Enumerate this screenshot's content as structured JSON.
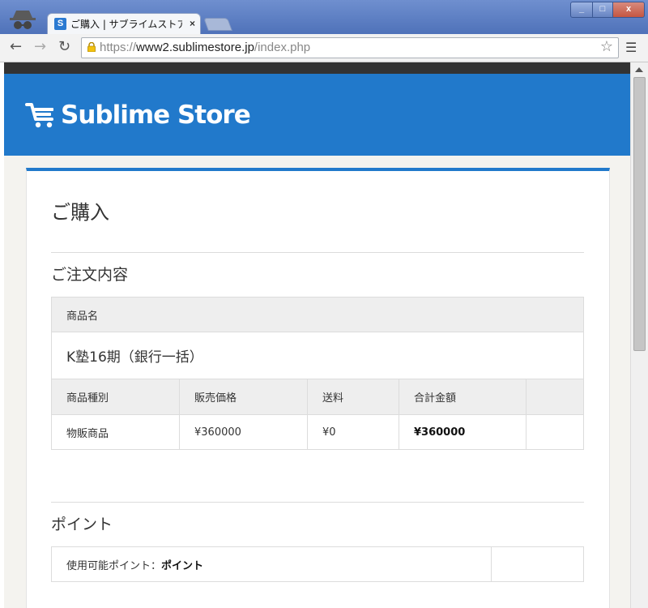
{
  "browser": {
    "tab_title": "ご購入 | サブライムストア",
    "tab_favicon": "S",
    "tab_close": "×",
    "url_scheme": "https://",
    "url_host": "www2.sublimestore.jp",
    "url_path": "/index.php",
    "icons": [
      "incognito-icon",
      "back-icon",
      "forward-icon",
      "reload-icon",
      "lock-icon",
      "star-icon",
      "menu-icon"
    ]
  },
  "site": {
    "brand": "Sublime Store",
    "brand_color": "#2179cb"
  },
  "page": {
    "title": "ご購入",
    "order_section_title": "ご注文内容",
    "product_name_header": "商品名",
    "product_name": "K塾16期（銀行一括）",
    "columns": [
      "商品種別",
      "販売価格",
      "送料",
      "合計金額"
    ],
    "values": [
      "物販商品",
      "¥360000",
      "¥0",
      "¥360000"
    ],
    "points_section_title": "ポイント",
    "points_label": "使用可能ポイント：",
    "points_value": "ポイント"
  }
}
